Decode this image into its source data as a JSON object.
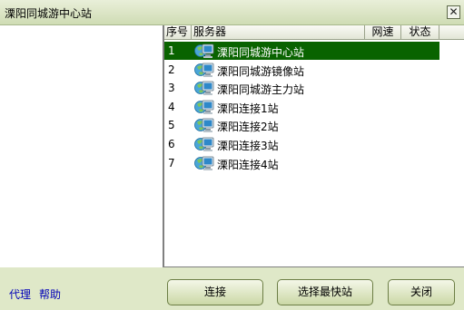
{
  "window": {
    "title": "溧阳同城游中心站",
    "close_glyph": "✕"
  },
  "footer_links": {
    "proxy": "代理",
    "help": "帮助"
  },
  "list": {
    "columns": {
      "index": "序号",
      "server": "服务器",
      "speed": "网速",
      "status": "状态"
    },
    "rows": [
      {
        "index": "1",
        "name": "溧阳同城游中心站",
        "selected": true
      },
      {
        "index": "2",
        "name": "溧阳同城游镜像站"
      },
      {
        "index": "3",
        "name": "溧阳同城游主力站"
      },
      {
        "index": "4",
        "name": "溧阳连接1站"
      },
      {
        "index": "5",
        "name": "溧阳连接2站"
      },
      {
        "index": "6",
        "name": "溧阳连接3站"
      },
      {
        "index": "7",
        "name": "溧阳连接4站"
      }
    ]
  },
  "buttons": {
    "connect": "连接",
    "fastest": "选择最快站",
    "close": "关闭"
  },
  "colors": {
    "selection": "#096300",
    "background": "#dfe8c8",
    "link": "#0000b8"
  },
  "icons": {
    "server_row": "network-computer-icon",
    "close": "close-icon"
  }
}
